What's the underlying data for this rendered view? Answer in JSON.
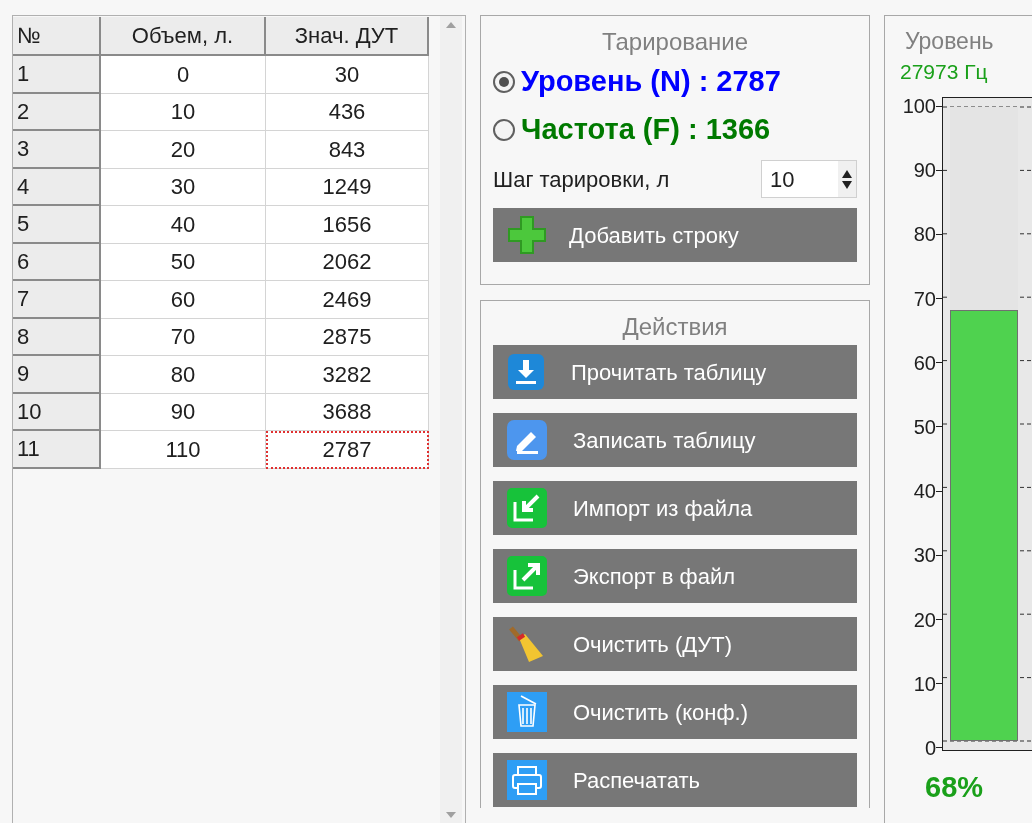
{
  "table": {
    "columns": [
      "№",
      "Объем, л.",
      "Знач. ДУТ"
    ],
    "rows": [
      {
        "cells": [
          "1",
          "0",
          "30"
        ],
        "focused": false
      },
      {
        "cells": [
          "2",
          "10",
          "436"
        ],
        "focused": false
      },
      {
        "cells": [
          "3",
          "20",
          "843"
        ],
        "focused": false
      },
      {
        "cells": [
          "4",
          "30",
          "1249"
        ],
        "focused": false
      },
      {
        "cells": [
          "5",
          "40",
          "1656"
        ],
        "focused": false
      },
      {
        "cells": [
          "6",
          "50",
          "2062"
        ],
        "focused": false
      },
      {
        "cells": [
          "7",
          "60",
          "2469"
        ],
        "focused": false
      },
      {
        "cells": [
          "8",
          "70",
          "2875"
        ],
        "focused": false
      },
      {
        "cells": [
          "9",
          "80",
          "3282"
        ],
        "focused": false
      },
      {
        "cells": [
          "10",
          "90",
          "3688"
        ],
        "focused": false
      },
      {
        "cells": [
          "11",
          "110",
          "2787"
        ],
        "focused": true
      }
    ]
  },
  "calibration": {
    "title": "Тарирование",
    "modes": [
      {
        "label": "Уровень (N) : 2787",
        "selected": true,
        "color": "#0000ff"
      },
      {
        "label": "Частота (F) : 1366",
        "selected": false,
        "color": "#007a00"
      }
    ],
    "step_label": "Шаг тарировки, л",
    "step_value": "10",
    "add_button": "Добавить строку"
  },
  "actions": {
    "title": "Действия",
    "buttons": [
      {
        "label": "Прочитать таблицу",
        "kind": "download"
      },
      {
        "label": "Записать таблицу",
        "kind": "write"
      },
      {
        "label": "Импорт из файла",
        "kind": "import"
      },
      {
        "label": "Экспорт в файл",
        "kind": "export"
      },
      {
        "label": "Очистить (ДУТ)",
        "kind": "broom"
      },
      {
        "label": "Очистить (конф.)",
        "kind": "trash"
      },
      {
        "label": "Распечатать",
        "kind": "print"
      }
    ]
  },
  "level_panel": {
    "title": "Уровень",
    "frequency": "27973 Гц",
    "scale": [
      "100",
      "90",
      "80",
      "70",
      "60",
      "50",
      "40",
      "30",
      "20",
      "10",
      "0"
    ],
    "level": 0.68,
    "percent": "68%"
  }
}
